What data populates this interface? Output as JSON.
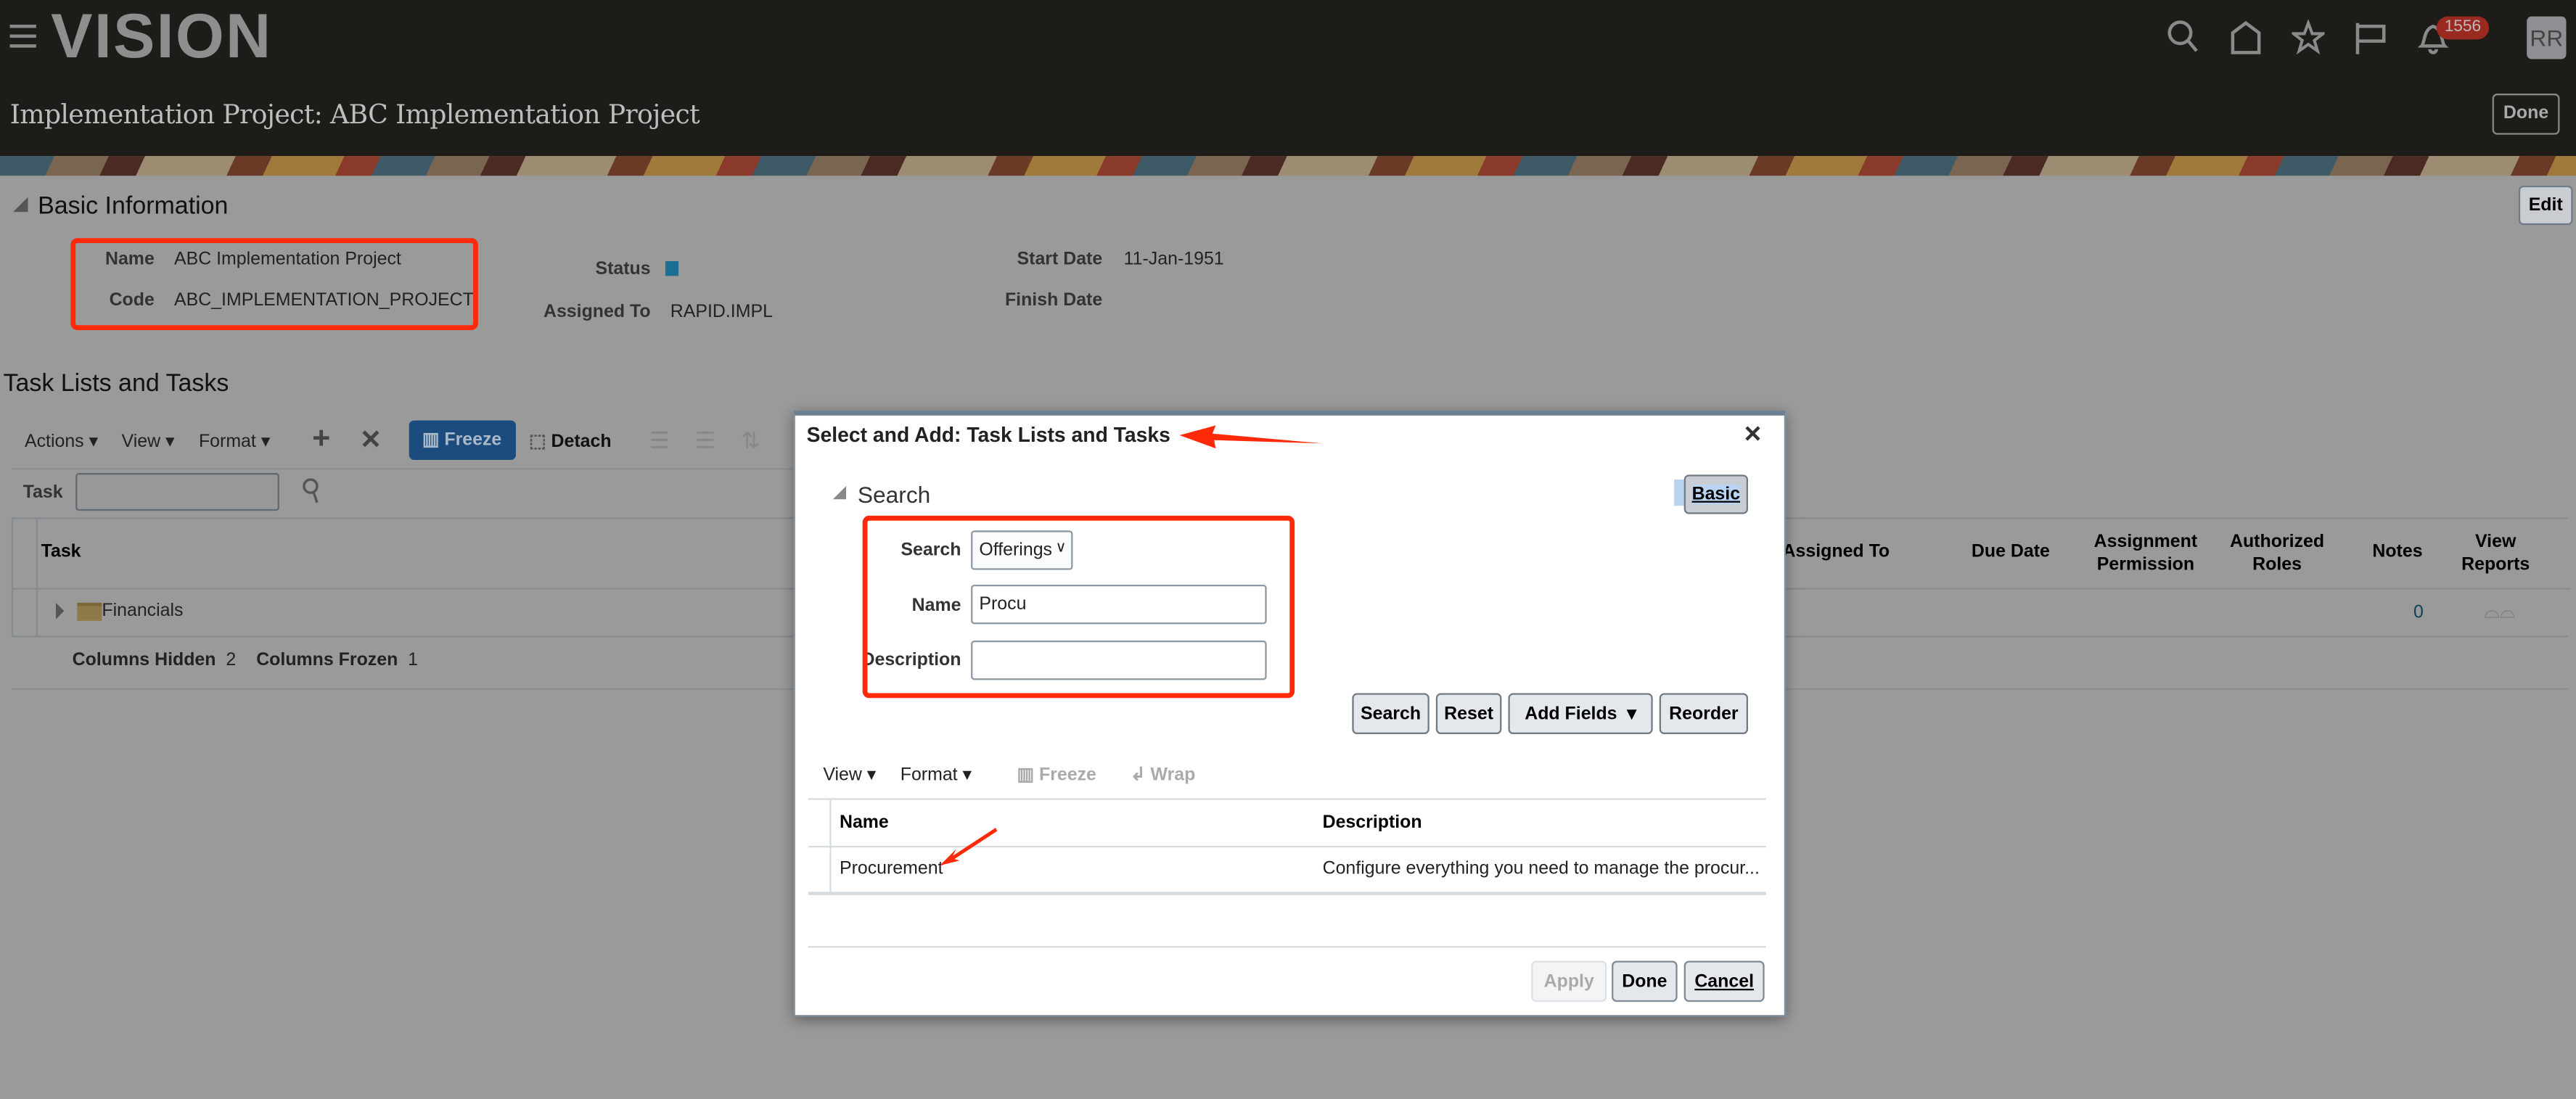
{
  "header": {
    "logo": "VISION",
    "notification_count": "1556",
    "avatar": "RR",
    "page_title": "Implementation Project: ABC Implementation Project",
    "done_label": "Done"
  },
  "basic_info": {
    "heading": "Basic Information",
    "edit_label": "Edit",
    "name_label": "Name",
    "name_value": "ABC Implementation Project",
    "code_label": "Code",
    "code_value": "ABC_IMPLEMENTATION_PROJECT",
    "status_label": "Status",
    "status_color": "#1e8fbf",
    "assigned_label": "Assigned To",
    "assigned_value": "RAPID.IMPL",
    "start_label": "Start Date",
    "start_value": "11-Jan-1951",
    "finish_label": "Finish Date"
  },
  "tasks": {
    "heading": "Task Lists and Tasks",
    "toolbar": {
      "actions": "Actions",
      "view": "View",
      "format": "Format",
      "freeze": "Freeze",
      "detach": "Detach"
    },
    "filter_label": "Task",
    "columns": [
      "Task",
      "Assigned To",
      "Due Date",
      "Assignment Permission",
      "Authorized Roles",
      "Notes",
      "View Reports"
    ],
    "rows": [
      {
        "task": "Financials",
        "notes": "0"
      }
    ],
    "footer": {
      "hidden_label": "Columns Hidden",
      "hidden_value": "2",
      "frozen_label": "Columns Frozen",
      "frozen_value": "1"
    }
  },
  "dialog": {
    "title": "Select and Add: Task Lists and Tasks",
    "search_heading": "Search",
    "basic_label": "Basic",
    "search_label": "Search",
    "search_value": "Offerings",
    "name_label": "Name",
    "name_value": "Procu",
    "description_label": "Description",
    "description_value": "",
    "buttons": {
      "search": "Search",
      "reset": "Reset",
      "add_fields": "Add Fields",
      "reorder": "Reorder",
      "apply": "Apply",
      "done": "Done",
      "cancel": "Cancel"
    },
    "toolbar": {
      "view": "View",
      "format": "Format",
      "freeze": "Freeze",
      "wrap": "Wrap"
    },
    "columns": [
      "Name",
      "Description"
    ],
    "rows": [
      {
        "name": "Procurement",
        "description": "Configure everything you need to manage the procur..."
      }
    ]
  },
  "colors": {
    "accent": "#1b4c7d",
    "annotation": "#ff2a0a",
    "badge": "#9a2a20"
  }
}
